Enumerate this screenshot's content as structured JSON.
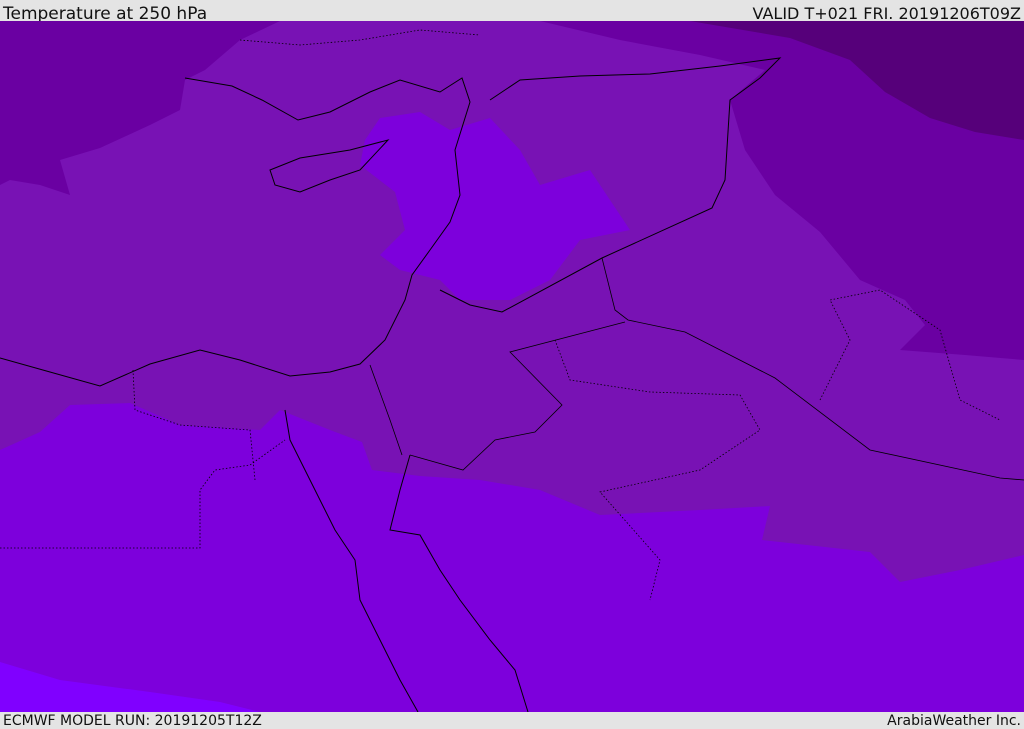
{
  "header": {
    "title": "Temperature at 250 hPa",
    "valid": "VALID T+021 FRI. 20191206T09Z"
  },
  "footer": {
    "model_run": "ECMWF MODEL RUN: 20191205T12Z",
    "credit": "ArabiaWeather Inc."
  },
  "colors": {
    "base": "#7812b4",
    "light": "#7d00dc",
    "dark": "#6a00a2",
    "darkest": "#56007a",
    "brightest": "#8000ff",
    "coast": "#000000"
  }
}
